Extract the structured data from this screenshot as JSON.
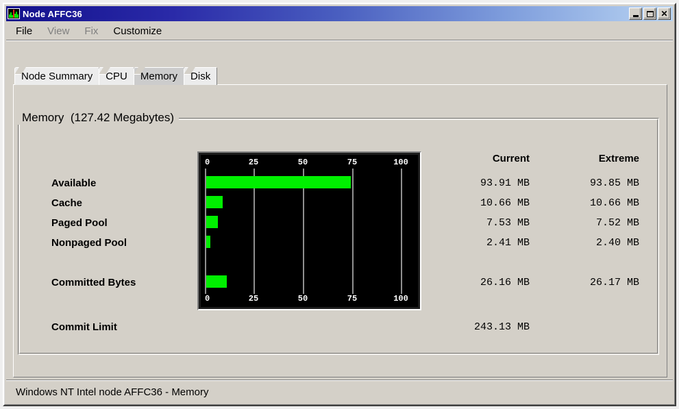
{
  "window": {
    "title": "Node AFFC36",
    "icon": "barchart-icon",
    "controls": [
      {
        "name": "minimize",
        "glyph": "_"
      },
      {
        "name": "maximize",
        "glyph": "□"
      },
      {
        "name": "close",
        "glyph": "✕"
      }
    ]
  },
  "menu": {
    "items": [
      {
        "label": "File",
        "disabled": false
      },
      {
        "label": "View",
        "disabled": true
      },
      {
        "label": "Fix",
        "disabled": true
      },
      {
        "label": "Customize",
        "disabled": false
      }
    ]
  },
  "tabs": [
    {
      "label": "Node Summary",
      "selected": false
    },
    {
      "label": "CPU",
      "selected": false
    },
    {
      "label": "Memory",
      "selected": true
    },
    {
      "label": "Disk",
      "selected": false
    }
  ],
  "groupbox": {
    "title": "Memory  (127.42 Megabytes)"
  },
  "columns": {
    "current": "Current",
    "extreme": "Extreme"
  },
  "rows": [
    {
      "label": "Available",
      "current": "93.91 MB",
      "extreme": "93.85 MB"
    },
    {
      "label": "Cache",
      "current": "10.66 MB",
      "extreme": "10.66 MB"
    },
    {
      "label": "Paged Pool",
      "current": "7.53 MB",
      "extreme": "7.52 MB"
    },
    {
      "label": "Nonpaged Pool",
      "current": "2.41 MB",
      "extreme": "2.40 MB"
    },
    {
      "label": "Committed Bytes",
      "current": "26.16 MB",
      "extreme": "26.17 MB"
    },
    {
      "label": "Commit Limit",
      "current": "243.13 MB",
      "extreme": ""
    }
  ],
  "chart_data": {
    "type": "bar",
    "orientation": "horizontal",
    "title": "Memory  (127.42 Megabytes)",
    "xlabel": "",
    "ylabel": "",
    "xlim": [
      0,
      100
    ],
    "ticks": [
      0,
      25,
      50,
      75,
      100
    ],
    "tick_labels": [
      "0",
      "25",
      "50",
      "75",
      "100"
    ],
    "grid": true,
    "axis_top": true,
    "axis_bottom": true,
    "bar_color": "#00f000",
    "background": "#000000",
    "categories": [
      "Available",
      "Cache",
      "Paged Pool",
      "Nonpaged Pool",
      "Committed Bytes"
    ],
    "values": [
      73.7,
      8.4,
      5.9,
      1.9,
      10.5
    ],
    "value_labels_mb": [
      93.91,
      10.66,
      7.53,
      2.41,
      26.16
    ],
    "total_mb": 127.42
  },
  "statusbar": {
    "text": "Windows NT Intel node AFFC36 - Memory"
  },
  "colors": {
    "bar_green": "#00f000",
    "face": "#d4d0c8",
    "title_dark": "#12108c",
    "title_light": "#b9d4f2"
  }
}
